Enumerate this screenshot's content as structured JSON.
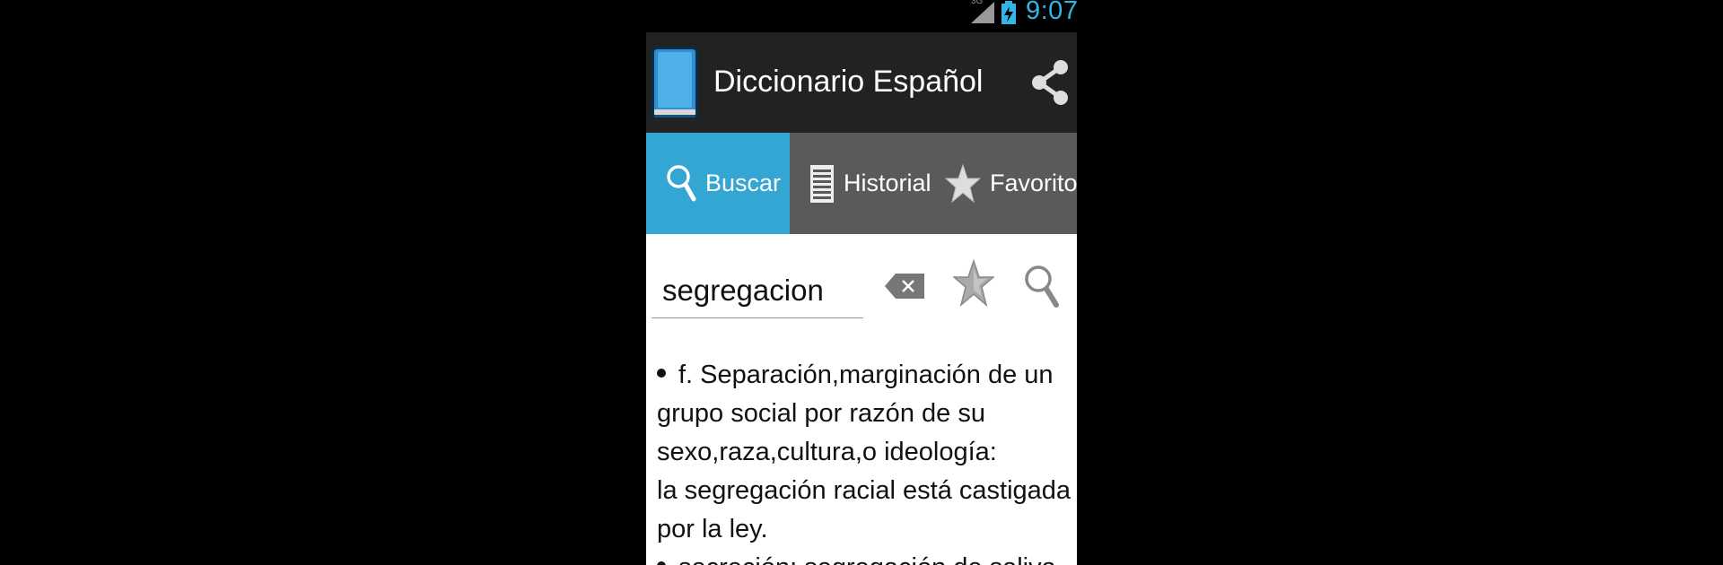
{
  "status_bar": {
    "network": "3G",
    "time": "9:07"
  },
  "action_bar": {
    "title": "Diccionario Español",
    "app_icon": "book-icon",
    "share_icon": "share-icon"
  },
  "tabs": [
    {
      "label": "Buscar",
      "icon": "search-icon",
      "active": true
    },
    {
      "label": "Historial",
      "icon": "list-icon",
      "active": false
    },
    {
      "label": "Favoritos",
      "icon": "star-icon",
      "active": false
    }
  ],
  "search": {
    "value": "segregacion"
  },
  "definitions": [
    {
      "text": "f. Separación,marginación de un grupo social por razón de su sexo,raza,cultura,o ideología:",
      "example": "la segregación racial está castigada por la ley."
    },
    {
      "text": "secreción: segregación de saliva.",
      "example": ""
    }
  ],
  "colors": {
    "accent": "#33a6d4",
    "status_text": "#33b5e5",
    "action_bar": "#222222",
    "tab_bar": "#5a5a5a"
  }
}
